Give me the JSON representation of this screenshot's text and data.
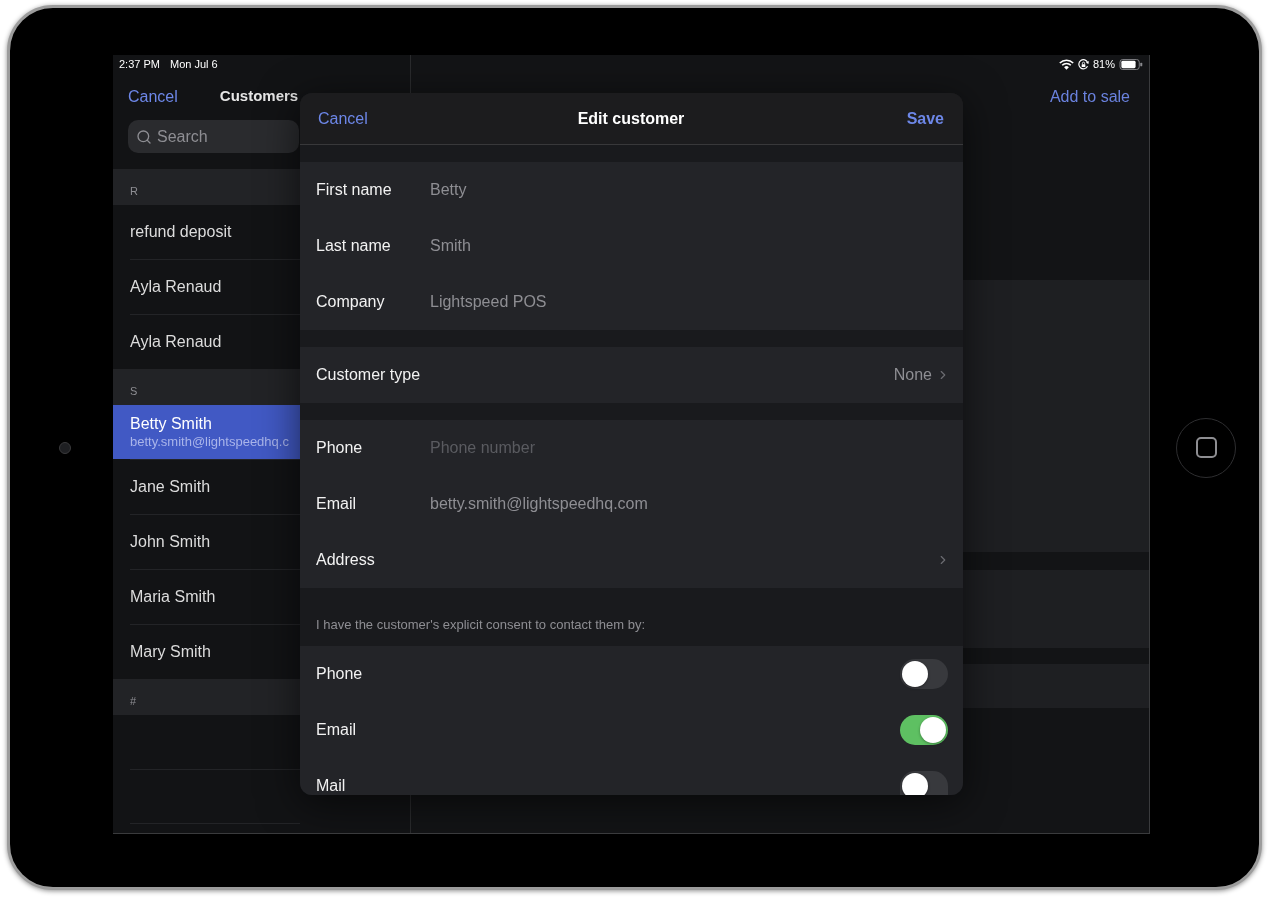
{
  "status_bar": {
    "time": "2:37 PM",
    "date": "Mon Jul 6",
    "battery": "81%"
  },
  "customers_pane": {
    "cancel": "Cancel",
    "title": "Customers",
    "search": {
      "placeholder": "Search"
    },
    "sections": [
      {
        "letter": "R",
        "items": [
          {
            "name": "refund deposit",
            "selected": false
          },
          {
            "name": "Ayla Renaud",
            "selected": false
          },
          {
            "name": "Ayla Renaud",
            "selected": false
          }
        ]
      },
      {
        "letter": "S",
        "items": [
          {
            "name": "Betty Smith",
            "email": "betty.smith@lightspeedhq.c",
            "selected": true
          },
          {
            "name": "Jane Smith",
            "selected": false
          },
          {
            "name": "John Smith",
            "selected": false
          },
          {
            "name": "Maria Smith",
            "selected": false
          },
          {
            "name": "Mary Smith",
            "selected": false
          }
        ]
      },
      {
        "letter": "#"
      }
    ]
  },
  "detail_pane": {
    "action": "Add to sale"
  },
  "edit_dialog": {
    "cancel": "Cancel",
    "title": "Edit customer",
    "save": "Save",
    "groups": [
      {
        "rows": [
          {
            "kind": "field",
            "label": "First name",
            "value": "Betty"
          },
          {
            "kind": "field",
            "label": "Last name",
            "value": "Smith"
          },
          {
            "kind": "field",
            "label": "Company",
            "value": "Lightspeed POS"
          }
        ]
      },
      {
        "rows": [
          {
            "kind": "link",
            "label": "Customer type",
            "value": "None"
          }
        ]
      },
      {
        "rows": [
          {
            "kind": "field",
            "label": "Phone",
            "placeholder": "Phone number"
          },
          {
            "kind": "field",
            "label": "Email",
            "value": "betty.smith@lightspeedhq.com"
          },
          {
            "kind": "link",
            "label": "Address"
          }
        ]
      },
      {
        "note": "I have the customer's explicit consent to contact them by:",
        "rows": [
          {
            "kind": "toggle",
            "label": "Phone",
            "on": false
          },
          {
            "kind": "toggle",
            "label": "Email",
            "on": true
          },
          {
            "kind": "toggle",
            "label": "Mail",
            "on": false
          }
        ]
      }
    ]
  }
}
